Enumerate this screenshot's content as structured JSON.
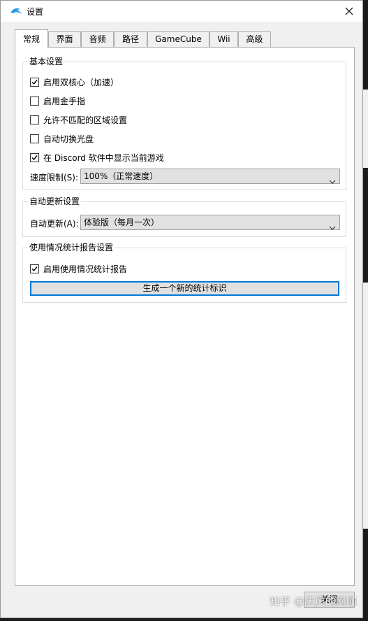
{
  "window": {
    "title": "设置",
    "app_icon": "dolphin-icon",
    "close_icon": "close-icon"
  },
  "tabs": [
    {
      "label": "常规",
      "active": true
    },
    {
      "label": "界面"
    },
    {
      "label": "音频"
    },
    {
      "label": "路径"
    },
    {
      "label": "GameCube"
    },
    {
      "label": "Wii"
    },
    {
      "label": "高级"
    }
  ],
  "basic": {
    "title": "基本设置",
    "checkboxes": [
      {
        "label": "启用双核心（加速）",
        "checked": true
      },
      {
        "label": "启用金手指",
        "checked": false
      },
      {
        "label": "允许不匹配的区域设置",
        "checked": false
      },
      {
        "label": "自动切换光盘",
        "checked": false
      },
      {
        "label": "在 Discord 软件中显示当前游戏",
        "checked": true
      }
    ],
    "speed_label": "速度限制(S):",
    "speed_value": "100%（正常速度）"
  },
  "update": {
    "title": "自动更新设置",
    "label": "自动更新(A):",
    "value": "体验版（每月一次）"
  },
  "stats": {
    "title": "使用情况统计报告设置",
    "checkbox": {
      "label": "启用使用情况统计报告",
      "checked": true
    },
    "button": "生成一个新的统计标识"
  },
  "close_button": "关闭",
  "watermark": "知乎 @庆风的网咖",
  "colors": {
    "focus": "#0078d7",
    "dolphin": "#2b9be5"
  }
}
